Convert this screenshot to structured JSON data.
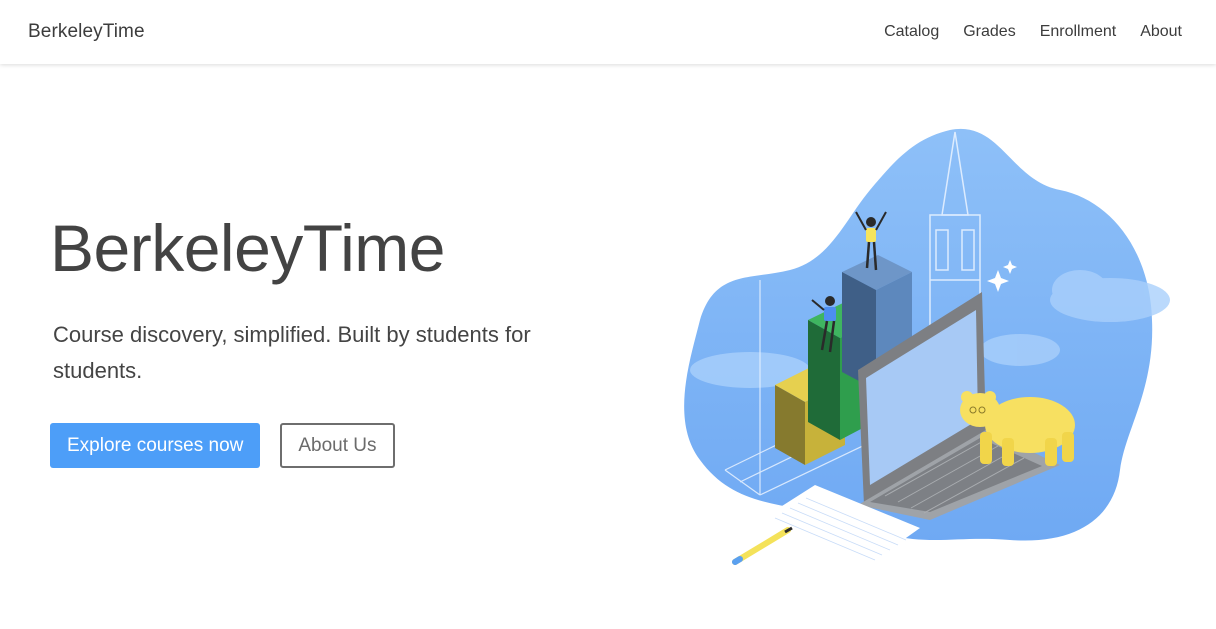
{
  "navbar": {
    "brand": "BerkeleyTime",
    "links": [
      "Catalog",
      "Grades",
      "Enrollment",
      "About"
    ]
  },
  "hero": {
    "title": "BerkeleyTime",
    "subtitle": "Course discovery, simplified. Built by students for students.",
    "primary_button": "Explore courses now",
    "secondary_button": "About Us"
  },
  "colors": {
    "primary": "#4d9ef8",
    "blob": "#7fb6f7",
    "bar_yellow": "#d4bf3a",
    "bar_green": "#2f9e4d",
    "bar_blue": "#5d88bd",
    "bear": "#f7e061"
  },
  "illustration": {
    "icon": "campus-chart-illustration"
  }
}
